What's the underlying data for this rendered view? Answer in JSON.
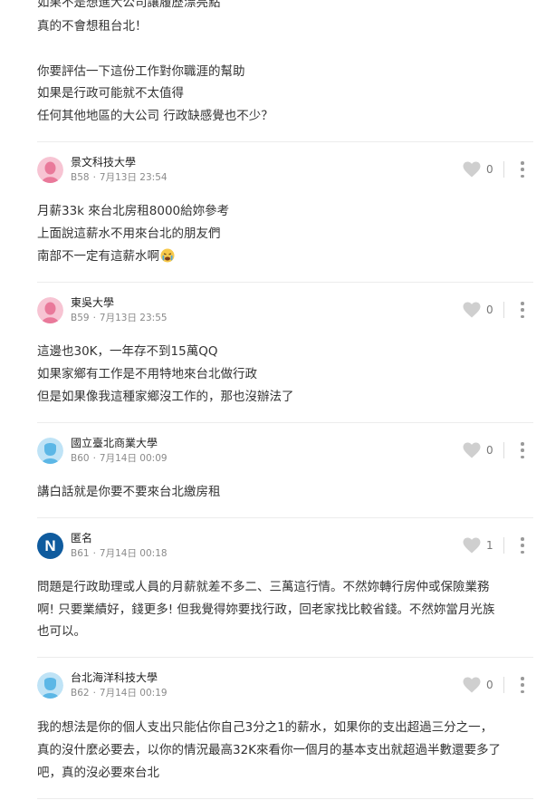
{
  "top_post": {
    "lines": [
      "如果不是想進大公司讓履歷漂亮點",
      "真的不會想租台北！",
      "你要評估一下這份工作對你職涯的幫助",
      "如果是行政可能就不太值得",
      "任何其他地區的大公司 行政缺感覺也不少？"
    ]
  },
  "comments": [
    {
      "author": "景文科技大學",
      "floor": "B58",
      "date": "7月13日 23:54",
      "likes": "0",
      "avatar_color": "#e9799a",
      "lines": [
        "月薪33k 來台北房租8000給妳參考",
        "上面說這薪水不用來台北的朋友們",
        "南部不一定有這薪水啊"
      ],
      "emoji": "crying-face"
    },
    {
      "author": "東吳大學",
      "floor": "B59",
      "date": "7月13日 23:55",
      "likes": "0",
      "avatar_color": "#e9799a",
      "lines": [
        "這邊也30K，一年存不到15萬QQ",
        "如果家鄉有工作是不用特地來台北做行政",
        "但是如果像我這種家鄉沒工作的，那也沒辦法了"
      ]
    },
    {
      "author": "國立臺北商業大學",
      "floor": "B60",
      "date": "7月14日 00:09",
      "likes": "0",
      "avatar_color": "#5cb7e6",
      "lines": [
        "講白話就是你要不要來台北繳房租"
      ]
    },
    {
      "author": "匿名",
      "floor": "B61",
      "date": "7月14日 00:18",
      "likes": "1",
      "avatar_letter": "N",
      "avatar_color": "#0f5b9e",
      "lines": [
        "問題是行政助理或人員的月薪就差不多二、三萬這行情。不然妳轉行房仲或保險業務",
        "啊! 只要業績好，錢更多! 但我覺得妳要找行政，回老家找比較省錢。不然妳當月光族",
        "也可以。"
      ]
    },
    {
      "author": "台北海洋科技大學",
      "floor": "B62",
      "date": "7月14日 00:19",
      "likes": "0",
      "avatar_color": "#5cb7e6",
      "lines": [
        "我的想法是你的個人支出只能佔你自己3分之1的薪水，如果你的支出超過三分之一，",
        "真的沒什麼必要去，以你的情況最高32K來看你一個月的基本支出就超過半數還要多了",
        "吧，真的沒必要來台北"
      ]
    }
  ]
}
